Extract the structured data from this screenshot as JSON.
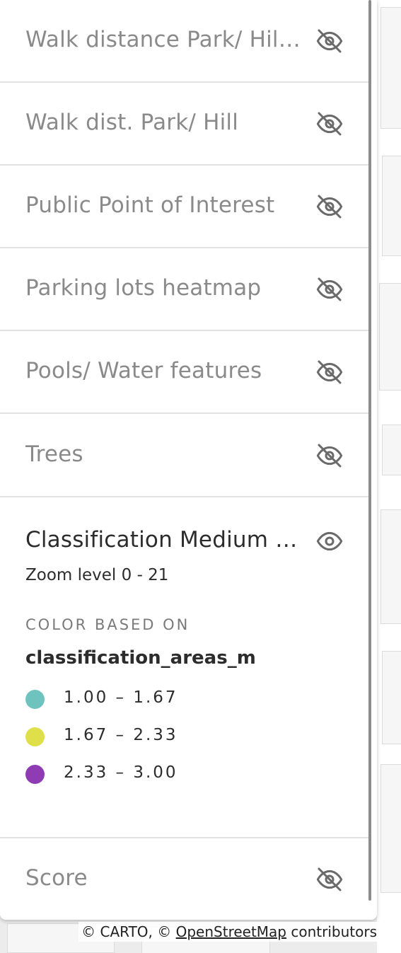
{
  "layers": [
    {
      "title": "Walk distance Park/ Hill …",
      "visible": false,
      "icon": "eye-off-icon"
    },
    {
      "title": "Walk dist. Park/ Hill",
      "visible": false,
      "icon": "eye-off-icon"
    },
    {
      "title": "Public Point of Interest",
      "visible": false,
      "icon": "eye-off-icon"
    },
    {
      "title": "Parking lots heatmap",
      "visible": false,
      "icon": "eye-off-icon"
    },
    {
      "title": "Pools/ Water features",
      "visible": false,
      "icon": "eye-off-icon"
    },
    {
      "title": "Trees",
      "visible": false,
      "icon": "eye-off-icon"
    }
  ],
  "expanded_layer": {
    "title": "Classification Medium Ar…",
    "visible": true,
    "icon": "eye-icon",
    "zoom": "Zoom level 0 - 21",
    "color_based_on": "COLOR BASED ON",
    "field": "classification_areas_m",
    "legend": [
      {
        "label": "1.00 – 1.67",
        "color": "#6fc3bf"
      },
      {
        "label": "1.67 – 2.33",
        "color": "#dfdf49"
      },
      {
        "label": "2.33 – 3.00",
        "color": "#8f3bb3"
      }
    ]
  },
  "last_layer": {
    "title": "Score",
    "visible": false,
    "icon": "eye-off-icon"
  },
  "attribution": {
    "prefix": "© CARTO, © ",
    "link": "OpenStreetMap",
    "suffix": " contributors"
  }
}
